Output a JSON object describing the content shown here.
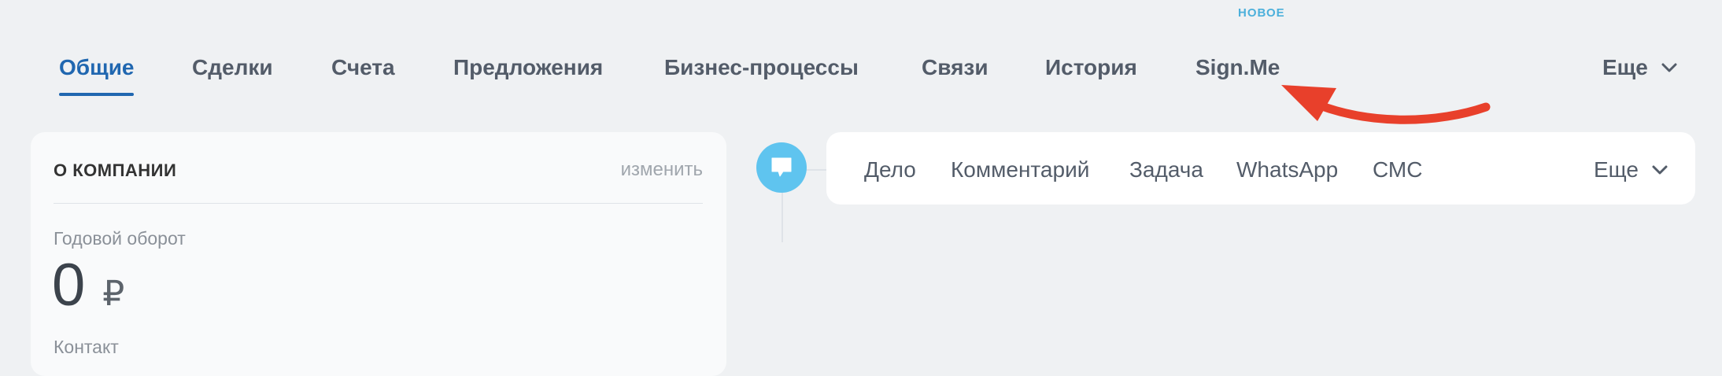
{
  "tabs": {
    "items": [
      {
        "label": "Общие"
      },
      {
        "label": "Сделки"
      },
      {
        "label": "Счета"
      },
      {
        "label": "Предложения"
      },
      {
        "label": "Бизнес-процессы"
      },
      {
        "label": "Связи"
      },
      {
        "label": "История"
      },
      {
        "label": "Sign.Me"
      }
    ],
    "active_index": 0,
    "more_label": "Еще"
  },
  "company_card": {
    "title": "О КОМПАНИИ",
    "edit_label": "изменить",
    "revenue_label": "Годовой оборот",
    "revenue_value": "0",
    "revenue_currency": "₽",
    "contact_label": "Контакт"
  },
  "composer": {
    "items": [
      {
        "label": "Дело"
      },
      {
        "label": "Комментарий"
      },
      {
        "label": "Задача"
      },
      {
        "label": "WhatsApp"
      },
      {
        "label": "СМС"
      }
    ],
    "new_badge": "НОВОЕ",
    "more_label": "Еще"
  },
  "icons": {
    "timeline": "chat-bubble-icon",
    "dropdown": "chevron-down-icon",
    "annotation": "red-arrow-icon"
  },
  "colors": {
    "accent": "#2067b0",
    "annotation": "#e8402b",
    "timeline_icon_bg": "#5fc4ef",
    "new_badge": "#4cb0db",
    "background": "#eff1f3"
  }
}
